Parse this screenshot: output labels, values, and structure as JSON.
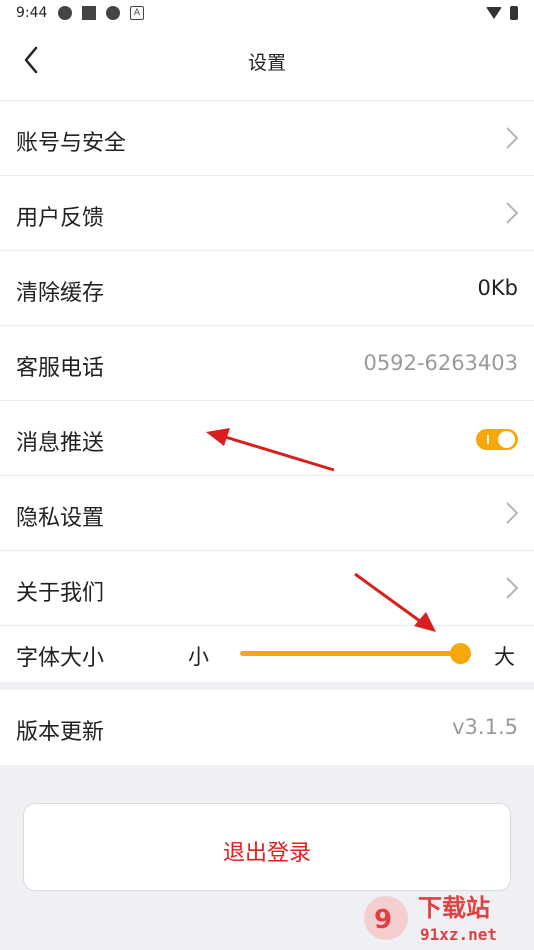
{
  "status_bar": {
    "time": "9:44",
    "icons_left": [
      "app-icon",
      "square-icon",
      "app-icon",
      "a-icon"
    ],
    "icons_right": [
      "wifi-icon",
      "battery-icon"
    ]
  },
  "header": {
    "title": "设置",
    "back_icon": "chevron-left-icon"
  },
  "rows": [
    {
      "label": "账号与安全",
      "trailing": "chevron-right-icon"
    },
    {
      "label": "用户反馈",
      "trailing": "chevron-right-icon"
    },
    {
      "label": "清除缓存",
      "value": "0Kb"
    },
    {
      "label": "客服电话",
      "value": "0592-6263403"
    },
    {
      "label": "消息推送",
      "toggle": true
    },
    {
      "label": "隐私设置",
      "trailing": "chevron-right-icon"
    },
    {
      "label": "关于我们",
      "trailing": "chevron-right-icon"
    }
  ],
  "font_size": {
    "label": "字体大小",
    "min_label": "小",
    "max_label": "大",
    "level": 1.0
  },
  "version": {
    "label": "版本更新",
    "value": "v3.1.5"
  },
  "logout": {
    "label": "退出登录"
  },
  "watermark": {
    "text": "下载站",
    "domain": "91xz.net"
  },
  "colors": {
    "accent": "#f6a80a",
    "danger": "#e02020",
    "arrow": "#d81e1e"
  }
}
